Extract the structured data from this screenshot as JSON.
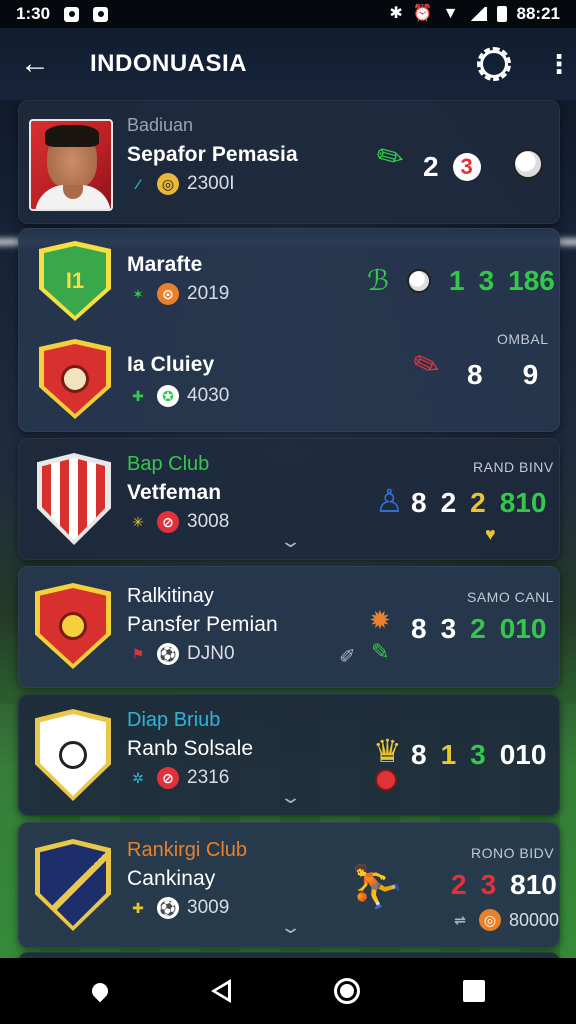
{
  "status_bar": {
    "time_left": "1:30",
    "time_right": "88:21"
  },
  "app_bar": {
    "back_icon": "arrow-left-icon",
    "title": "INDONUASIA",
    "settings_icon": "gear-icon",
    "more_icon": "more-vert-icon"
  },
  "cards": [
    {
      "rows": [
        {
          "subtitle": "Badiuan",
          "name": "Sepafor Pemasia",
          "meta": "2300I",
          "stats": [
            "2",
            "3"
          ]
        }
      ]
    },
    {
      "rows": [
        {
          "crest_text": "I1",
          "name": "Marafte",
          "meta": "2019",
          "stats": [
            "1",
            "3",
            "186"
          ]
        },
        {
          "label": "OMBAL",
          "name": "Ia Cluiey",
          "meta": "4030",
          "stats": [
            "8",
            "9"
          ]
        }
      ]
    },
    {
      "rows": [
        {
          "subtitle": "Bap Club",
          "label": "RAND BINV",
          "name": "Vetfeman",
          "meta": "3008",
          "stats": [
            "8",
            "2",
            "2",
            "810"
          ]
        }
      ]
    },
    {
      "rows": [
        {
          "subtitle": "Ralkitinay",
          "label": "SAMO CANL",
          "name": "Pansfer Pemian",
          "meta": "DJN0",
          "stats": [
            "8",
            "3",
            "2",
            "010"
          ]
        }
      ]
    },
    {
      "rows": [
        {
          "subtitle": "Diap Briub",
          "name": "Ranb Solsale",
          "meta": "2316",
          "stats": [
            "8",
            "1",
            "3",
            "010"
          ]
        }
      ]
    },
    {
      "rows": [
        {
          "subtitle": "Rankirgi Club",
          "label": "RONO BIDV",
          "name": "Cankinay",
          "meta": "3009",
          "stats": [
            "2",
            "3",
            "810"
          ],
          "extra_meta": "80000"
        }
      ]
    }
  ],
  "colors": {
    "green_stat": "#34c84a",
    "yellow_stat": "#e9c630",
    "red_stat": "#e0323a",
    "orange_subtitle": "#e8802c",
    "teal_subtitle": "#2fb4d6"
  }
}
